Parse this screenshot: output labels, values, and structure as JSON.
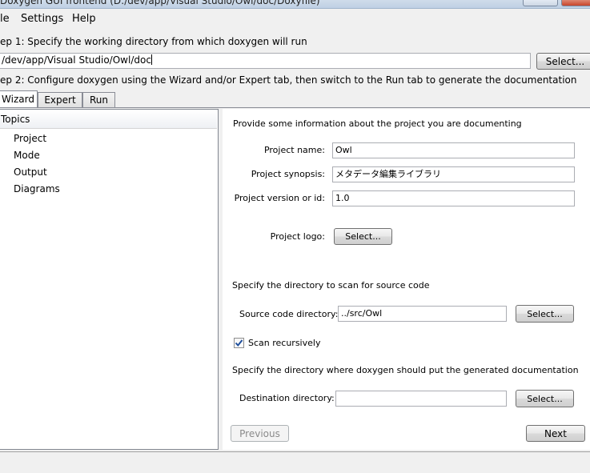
{
  "window": {
    "title": "Doxygen GUI frontend (D:/dev/app/Visual Studio/Owl/doc/Doxyfile)"
  },
  "menubar": {
    "items": [
      {
        "label": "le"
      },
      {
        "label": "Settings"
      },
      {
        "label": "Help"
      }
    ]
  },
  "step1": {
    "label": "ep 1: Specify the working directory from which doxygen will run",
    "working_dir_value": "/dev/app/Visual Studio/Owl/doc",
    "select_label": "Select..."
  },
  "step2": {
    "label": "ep 2: Configure doxygen using the Wizard and/or Expert tab, then switch to the Run tab to generate the documentation"
  },
  "tabs": [
    {
      "label": "Wizard",
      "active": true
    },
    {
      "label": "Expert",
      "active": false
    },
    {
      "label": "Run",
      "active": false
    }
  ],
  "topics": {
    "header": "Topics",
    "items": [
      "Project",
      "Mode",
      "Output",
      "Diagrams"
    ]
  },
  "project": {
    "intro": "Provide some information about the project you are documenting",
    "name_label": "Project name:",
    "name_value": "Owl",
    "synopsis_label": "Project synopsis:",
    "synopsis_value": "メタデータ編集ライブラリ",
    "version_label": "Project version or id:",
    "version_value": "1.0",
    "logo_label": "Project logo:",
    "logo_button": "Select..."
  },
  "source": {
    "intro": "Specify the directory to scan for source code",
    "dir_label": "Source code directory:",
    "dir_value": "../src/Owl",
    "select_label": "Select...",
    "scan_recursively_label": "Scan recursively",
    "scan_recursively_checked": true
  },
  "destination": {
    "intro": "Specify the directory where doxygen should put the generated documentation",
    "dir_label": "Destination directory:",
    "dir_value": "",
    "select_label": "Select..."
  },
  "nav": {
    "previous_label": "Previous",
    "next_label": "Next"
  },
  "colors": {
    "window_bg": "#f0f0f0",
    "panel_bg": "#ffffff",
    "checkbox_check": "#1f4f9c"
  }
}
